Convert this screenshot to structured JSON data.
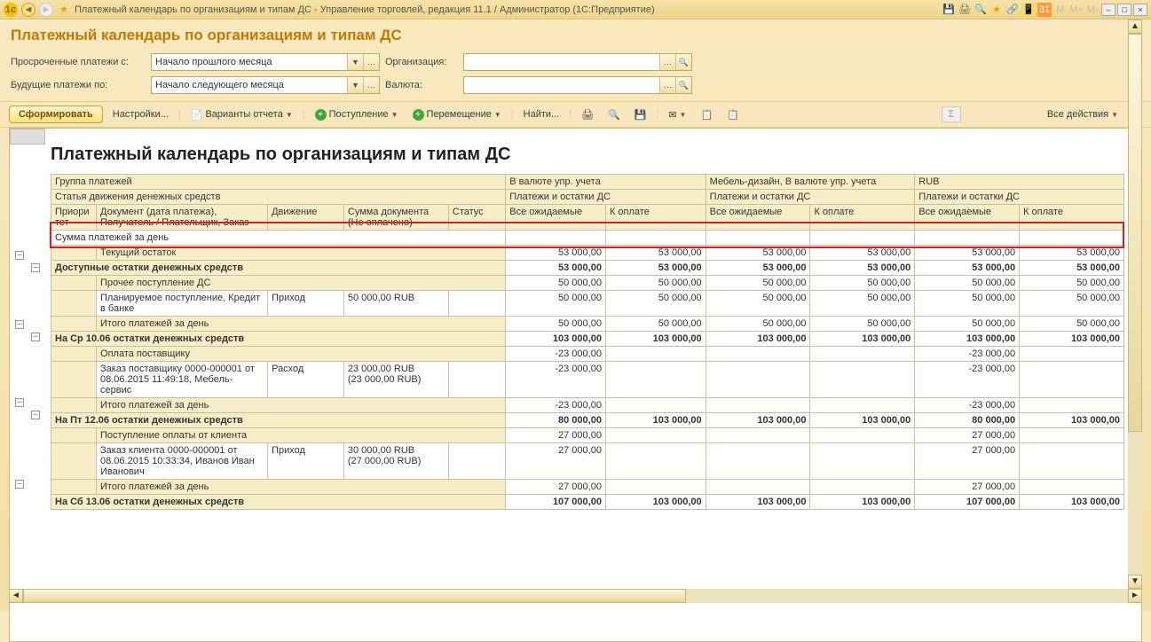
{
  "window": {
    "title": "Платежный календарь по организациям и типам ДС - Управление торговлей, редакция 11.1 / Администратор  (1С:Предприятие)",
    "tb_labels": {
      "m": "M",
      "mplus": "M+",
      "mminus": "M-"
    }
  },
  "page_title": "Платежный календарь по организациям и типам ДС",
  "filters": {
    "row1_label": "Просроченные платежи с:",
    "row1_value": "Начало прошлого месяца",
    "row1_label2": "Организация:",
    "row1_value2": "",
    "row2_label": "Будущие платежи по:",
    "row2_value": "Начало следующего месяца",
    "row2_label2": "Валюта:",
    "row2_value2": ""
  },
  "toolbar": {
    "form": "Сформировать",
    "settings": "Настройки...",
    "variants": "Варианты отчета",
    "inflow": "Поступление",
    "move": "Перемещение",
    "find": "Найти...",
    "all_actions": "Все действия"
  },
  "report": {
    "title": "Платежный календарь по организациям и типам ДС",
    "header": {
      "group": "Группа платежей",
      "col1": "В валюте упр. учета",
      "col2": "Мебель-дизайн, В валюте упр. учета",
      "col3": "RUB",
      "article": "Статья движения денежных средств",
      "payments": "Платежи и остатки ДС",
      "priority": "Приори\nтет",
      "doc": "Документ (дата платежа), Получатель / Плательщик, Заказ",
      "move": "Движение",
      "sum": "Сумма документа (Не оплачено)",
      "status": "Статус",
      "expected": "Все ожидаемые",
      "topay": "К оплате"
    },
    "rows": {
      "r1": {
        "label": "Сумма платежей за день"
      },
      "r2": {
        "label": "Текущий остаток",
        "v": [
          "53 000,00",
          "53 000,00",
          "53 000,00",
          "53 000,00",
          "53 000,00",
          "53 000,00"
        ]
      },
      "r3": {
        "label": "Доступные остатки денежных средств",
        "v": [
          "53 000,00",
          "53 000,00",
          "53 000,00",
          "53 000,00",
          "53 000,00",
          "53 000,00"
        ]
      },
      "r4": {
        "label": "Прочее поступление ДС",
        "v": [
          "50 000,00",
          "50 000,00",
          "50 000,00",
          "50 000,00",
          "50 000,00",
          "50 000,00"
        ]
      },
      "r5": {
        "doc": "Планируемое поступление, Кредит в банке",
        "move": "Приход",
        "sum": "50 000,00 RUB",
        "v": [
          "50 000,00",
          "50 000,00",
          "50 000,00",
          "50 000,00",
          "50 000,00",
          "50 000,00"
        ]
      },
      "r6": {
        "label": "Итого платежей за день",
        "v": [
          "50 000,00",
          "50 000,00",
          "50 000,00",
          "50 000,00",
          "50 000,00",
          "50 000,00"
        ]
      },
      "r7": {
        "label": "На Ср 10.06 остатки денежных средств",
        "v": [
          "103 000,00",
          "103 000,00",
          "103 000,00",
          "103 000,00",
          "103 000,00",
          "103 000,00"
        ]
      },
      "r8": {
        "label": "Оплата поставщику",
        "v": [
          "-23 000,00",
          "",
          "",
          "",
          "-23 000,00",
          ""
        ]
      },
      "r9": {
        "doc": "Заказ поставщику 0000-000001 от 08.06.2015 11:49:18, Мебель-сервис",
        "move": "Расход",
        "sum": "23 000,00 RUB\n(23 000,00 RUB)",
        "v": [
          "-23 000,00",
          "",
          "",
          "",
          "-23 000,00",
          ""
        ]
      },
      "r10": {
        "label": "Итого платежей за день",
        "v": [
          "-23 000,00",
          "",
          "",
          "",
          "-23 000,00",
          ""
        ]
      },
      "r11": {
        "label": "На Пт 12.06 остатки денежных средств",
        "v": [
          "80 000,00",
          "103 000,00",
          "103 000,00",
          "103 000,00",
          "80 000,00",
          "103 000,00"
        ]
      },
      "r12": {
        "label": "Поступление оплаты от клиента",
        "v": [
          "27 000,00",
          "",
          "",
          "",
          "27 000,00",
          ""
        ]
      },
      "r13": {
        "doc": "Заказ клиента 0000-000001 от 08.06.2015 10:33:34, Иванов Иван Иванович",
        "move": "Приход",
        "sum": "30 000,00 RUB\n(27 000,00 RUB)",
        "v": [
          "27 000,00",
          "",
          "",
          "",
          "27 000,00",
          ""
        ]
      },
      "r14": {
        "label": "Итого платежей за день",
        "v": [
          "27 000,00",
          "",
          "",
          "",
          "27 000,00",
          ""
        ]
      },
      "r15": {
        "label": "На Сб 13.06 остатки денежных средств",
        "v": [
          "107 000,00",
          "103 000,00",
          "103 000,00",
          "103 000,00",
          "107 000,00",
          "103 000,00"
        ]
      }
    }
  }
}
